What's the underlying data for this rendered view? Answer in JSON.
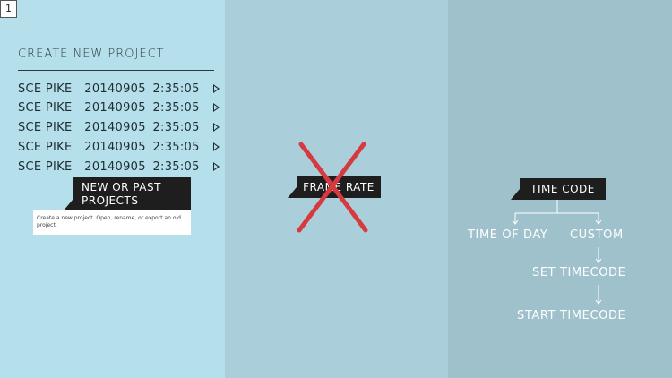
{
  "page_number": "1",
  "projects": {
    "title": "CREATE NEW PROJECT",
    "rows": [
      {
        "name": "SCE PIKE",
        "date": "20140905",
        "time": "2:35:05"
      },
      {
        "name": "SCE PIKE",
        "date": "20140905",
        "time": "2:35:05"
      },
      {
        "name": "SCE PIKE",
        "date": "20140905",
        "time": "2:35:05"
      },
      {
        "name": "SCE PIKE",
        "date": "20140905",
        "time": "2:35:05"
      },
      {
        "name": "SCE PIKE",
        "date": "20140905",
        "time": "2:35:05"
      }
    ],
    "label_line1": "NEW OR PAST",
    "label_line2": "PROJECTS",
    "tooltip": "Create a new project. Open, rename, or export an old project."
  },
  "frame_rate": {
    "label": "FRAME RATE",
    "cross_color": "#d63a3f"
  },
  "timecode": {
    "label": "TIME CODE",
    "option_time_of_day": "TIME OF DAY",
    "option_custom": "CUSTOM",
    "set_timecode": "SET TIMECODE",
    "start_timecode": "START TIMECODE"
  },
  "colors": {
    "col1": "#b5dfea",
    "col2": "#abcfda",
    "col3": "#9fc1cc",
    "label_bg": "#1e1e1e"
  }
}
